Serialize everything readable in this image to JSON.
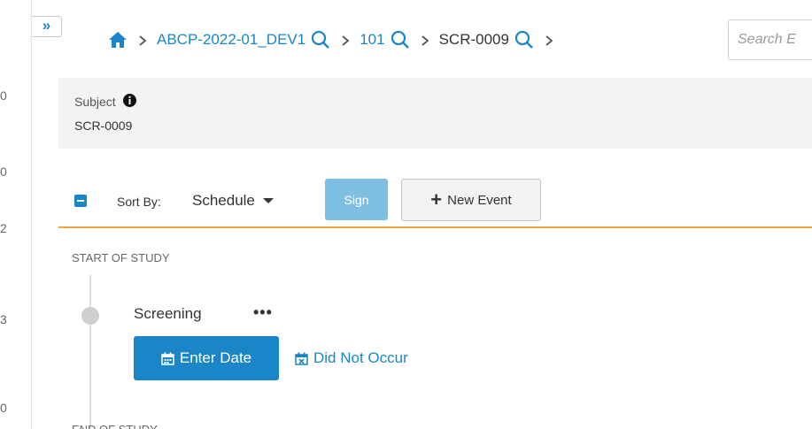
{
  "gutter": {
    "numbers": [
      "0",
      "0",
      "2",
      "3",
      "0"
    ]
  },
  "nav": {
    "expand_label": "»"
  },
  "breadcrumb": {
    "study": "ABCP-2022-01_DEV1",
    "site": "101",
    "subject": "SCR-0009",
    "search_placeholder": "Search E"
  },
  "subject_panel": {
    "label": "Subject",
    "value": "SCR-0009"
  },
  "toolbar": {
    "sort_label": "Sort By:",
    "sort_value": "Schedule",
    "sign_label": "Sign",
    "new_event_label": "New Event"
  },
  "timeline": {
    "start_label": "START OF STUDY",
    "end_label": "END OF STUDY",
    "events": [
      {
        "name": "Screening",
        "more_label": "•••",
        "enter_date_label": "Enter Date",
        "did_not_occur_label": "Did Not Occur"
      }
    ]
  },
  "colors": {
    "accent": "#1a86c8",
    "sign_disabled": "#7fc0e2",
    "divider": "#f0a241",
    "panel_bg": "#f3f3f3"
  }
}
